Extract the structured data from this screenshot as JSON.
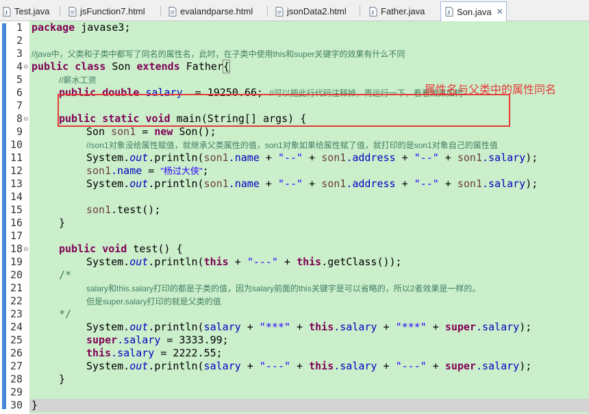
{
  "tabs": [
    {
      "label": "Test.java",
      "icon": "java-file-icon",
      "active": false
    },
    {
      "label": "jsFunction7.html",
      "icon": "html-file-icon",
      "active": false
    },
    {
      "label": "evalandparse.html",
      "icon": "html-file-icon",
      "active": false
    },
    {
      "label": "jsonData2.html",
      "icon": "html-file-icon",
      "active": false
    },
    {
      "label": "Father.java",
      "icon": "java-file-icon",
      "active": false
    },
    {
      "label": "Son.java",
      "icon": "java-file-icon",
      "active": true,
      "close": "✕"
    }
  ],
  "annotation": "属性名与父类中的属性同名",
  "line_numbers": [
    "1",
    "2",
    "3",
    "4",
    "5",
    "6",
    "7",
    "8",
    "9",
    "10",
    "11",
    "12",
    "13",
    "14",
    "15",
    "16",
    "17",
    "18",
    "19",
    "20",
    "21",
    "22",
    "23",
    "24",
    "25",
    "26",
    "27",
    "28",
    "29",
    "30"
  ],
  "code": {
    "l1_kw": "package",
    "l1_rest": " javase3;",
    "l3": "//java中，父类和子类中都写了同名的属性名，此时，在子类中使用this和super关键字的效果有什么不同",
    "l4_kw1": "public",
    "l4_kw2": "class",
    "l4_name": " Son ",
    "l4_kw3": "extends",
    "l4_rest": " Father",
    "l4_brace": "{",
    "l5": "//薪水工资",
    "l6_kw1": "public",
    "l6_kw2": "double",
    "l6_field": "salary",
    "l6_rest": "  = 19250.66; ",
    "l6_cm": "//可以把此行代码注释掉，再运行一下，看看效果如何",
    "l8_kw1": "public",
    "l8_kw2": "static",
    "l8_kw3": "void",
    "l8_rest": " main(String[] args) {",
    "l9_a": "Son ",
    "l9_var": "son1",
    "l9_b": " = ",
    "l9_kw": "new",
    "l9_c": " Son();",
    "l10": "//son1对象没给属性赋值，就继承父类属性的值，son1对象如果给属性赋了值，就打印的是son1对象自己的属性值",
    "l11_a": "System.",
    "l11_out": "out",
    "l11_b": ".println(",
    "l11_v1": "son1",
    "l11_f1": ".name",
    "l11_c": " + ",
    "l11_s1": "\"--\"",
    "l11_d": " + ",
    "l11_v2": "son1",
    "l11_f2": ".address",
    "l11_e": " + ",
    "l11_s2": "\"--\"",
    "l11_g": " + ",
    "l11_v3": "son1",
    "l11_f3": ".salary",
    "l11_h": ");",
    "l12_v": "son1",
    "l12_f": ".name",
    "l12_a": " = ",
    "l12_s": "\"杨过大侠\"",
    "l12_b": ";",
    "l15_v": "son1",
    "l15_rest": ".test();",
    "l16": "}",
    "l18_kw1": "public",
    "l18_kw2": "void",
    "l18_rest": " test() {",
    "l19_a": "System.",
    "l19_out": "out",
    "l19_b": ".println(",
    "l19_kw1": "this",
    "l19_c": " + ",
    "l19_s": "\"---\"",
    "l19_d": " + ",
    "l19_kw2": "this",
    "l19_e": ".getClass());",
    "l20": "/*",
    "l21": "salary和this.salary打印的都是子类的值，因为salary前面的this关键字是可以省略的，所以2者效果是一样的。",
    "l22": "但是super.salary打印的就是父类的值",
    "l23": "*/",
    "l24_a": "System.",
    "l24_out": "out",
    "l24_b": ".println(",
    "l24_f1": "salary",
    "l24_c": " + ",
    "l24_s1": "\"***\"",
    "l24_d": " + ",
    "l24_kw1": "this",
    "l24_f2": ".salary",
    "l24_e": " + ",
    "l24_s2": "\"***\"",
    "l24_g": " + ",
    "l24_kw2": "super",
    "l24_f3": ".salary",
    "l24_h": ");",
    "l25_kw": "super",
    "l25_f": ".salary",
    "l25_rest": " = 3333.99;",
    "l26_kw": "this",
    "l26_f": ".salary",
    "l26_rest": " = 2222.55;",
    "l27_a": "System.",
    "l27_out": "out",
    "l27_b": ".println(",
    "l27_f1": "salary",
    "l27_c": " + ",
    "l27_s1": "\"---\"",
    "l27_d": " + ",
    "l27_kw1": "this",
    "l27_f2": ".salary",
    "l27_e": " + ",
    "l27_s2": "\"---\"",
    "l27_g": " + ",
    "l27_kw2": "super",
    "l27_f3": ".salary",
    "l27_h": ");",
    "l28": "}",
    "l30": "}"
  }
}
